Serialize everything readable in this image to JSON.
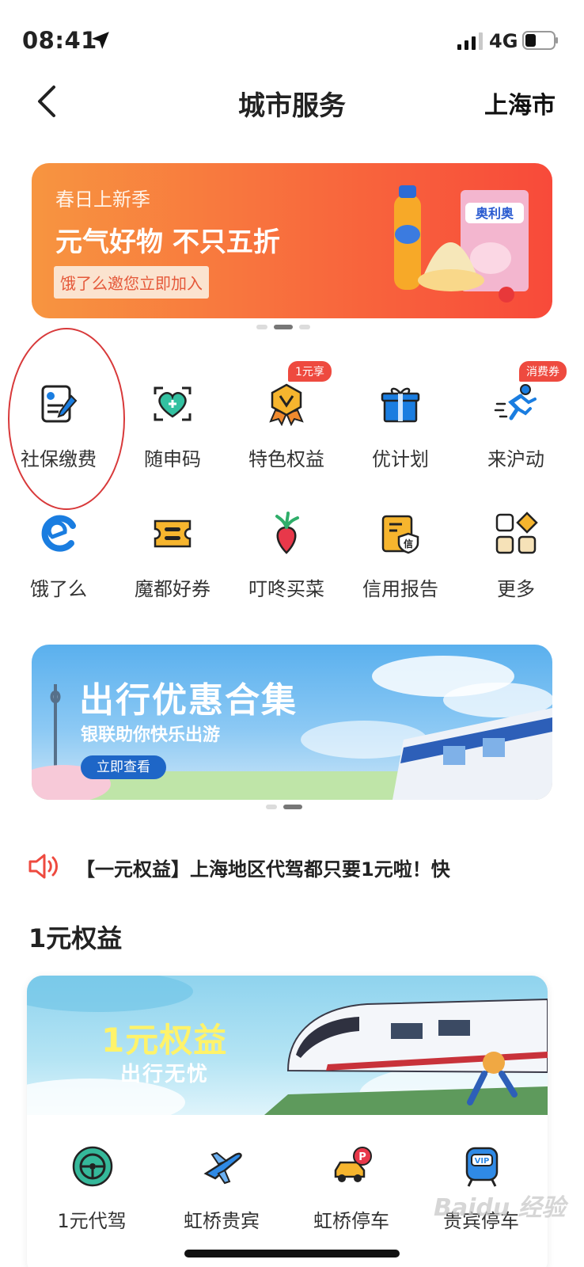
{
  "status_bar": {
    "time": "08:41",
    "network": "4G"
  },
  "nav": {
    "title": "城市服务",
    "city": "上海市"
  },
  "promo_banner": {
    "subtitle": "春日上新季",
    "headline": "元气好物 不只五折",
    "tag": "饿了么邀您立即加入",
    "product_text": "奥利奥"
  },
  "grid": [
    {
      "label": "社保缴费",
      "icon": "social-security-form-icon"
    },
    {
      "label": "随申码",
      "icon": "health-code-icon"
    },
    {
      "label": "特色权益",
      "icon": "medal-icon",
      "badge": "1元享"
    },
    {
      "label": "优计划",
      "icon": "gift-box-icon"
    },
    {
      "label": "来沪动",
      "icon": "running-man-icon",
      "badge": "消费券"
    },
    {
      "label": "饿了么",
      "icon": "eleme-icon"
    },
    {
      "label": "魔都好券",
      "icon": "coupon-icon"
    },
    {
      "label": "叮咚买菜",
      "icon": "radish-icon"
    },
    {
      "label": "信用报告",
      "icon": "credit-report-icon",
      "icon_text": "信"
    },
    {
      "label": "更多",
      "icon": "more-apps-icon"
    }
  ],
  "travel_banner": {
    "headline": "出行优惠合集",
    "subtitle": "银联助你快乐出游",
    "button": "立即查看"
  },
  "notice": {
    "text": "【一元权益】上海地区代驾都只要1元啦！快"
  },
  "section": {
    "title": "1元权益"
  },
  "benefit_card": {
    "hero_title": "1元权益",
    "hero_subtitle": "出行无忧",
    "services": [
      {
        "label": "1元代驾",
        "icon": "steering-wheel-icon"
      },
      {
        "label": "虹桥贵宾",
        "icon": "airplane-icon"
      },
      {
        "label": "虹桥停车",
        "icon": "parking-car-icon",
        "icon_text": "P"
      },
      {
        "label": "贵宾停车",
        "icon": "vip-train-icon",
        "icon_text": "VIP"
      }
    ]
  },
  "watermark": "Baidu 经验",
  "colors": {
    "accent_red": "#ee4a3f",
    "banner_orange": "#f86a3d",
    "icon_blue": "#1a7de0",
    "icon_yellow": "#f6b52e"
  }
}
